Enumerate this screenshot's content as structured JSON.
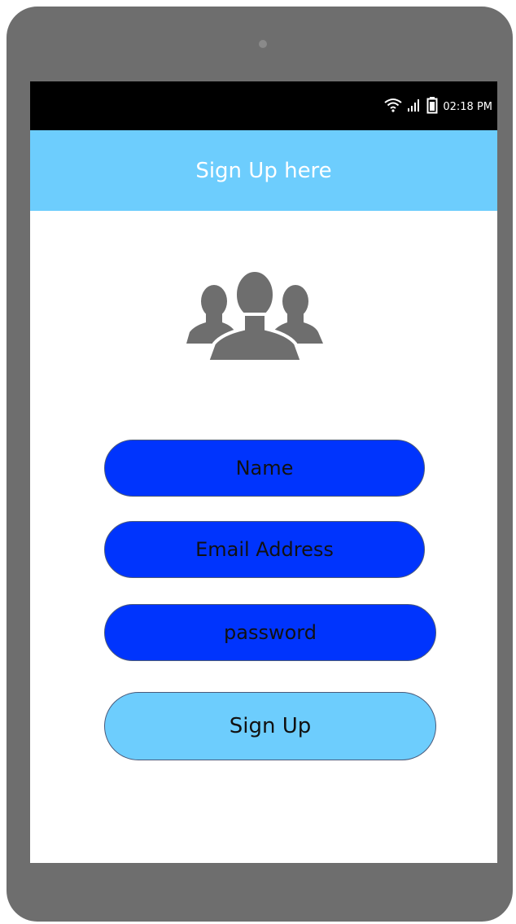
{
  "status_bar": {
    "time": "02:18 PM",
    "icons": [
      "wifi-icon",
      "signal-icon",
      "battery-icon"
    ]
  },
  "app_bar": {
    "title": "Sign Up here"
  },
  "hero": {
    "icon": "users-group-icon"
  },
  "form": {
    "name_label": "Name",
    "email_label": "Email Address",
    "password_label": "password",
    "submit_label": "Sign Up"
  },
  "colors": {
    "device_frame": "#6e6e6e",
    "status_bar": "#000000",
    "app_bar": "#6dcdfd",
    "field_fill": "#0034fd",
    "button_fill": "#6dcdfd",
    "icon": "#6e6e6e"
  }
}
